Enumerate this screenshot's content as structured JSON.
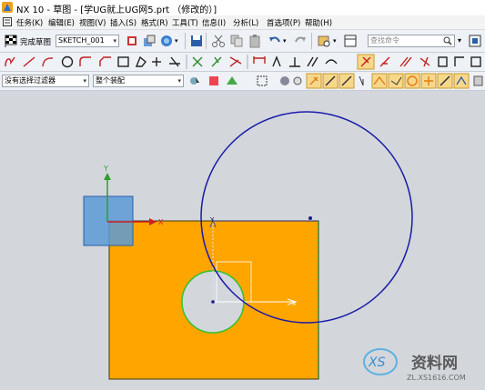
{
  "window": {
    "title": "NX 10 - 草图 - [学UG就上UG网5.prt （修改的）]"
  },
  "menu": {
    "items": [
      "任务(K)",
      "编辑(E)",
      "视图(V)",
      "插入(S)",
      "格式(R)",
      "工具(T)",
      "信息(I)",
      "分析(L)",
      "首选项(P)",
      "帮助(H)"
    ]
  },
  "toolbar1": {
    "finish_sketch_label": "完成草图",
    "sketch_name": "SKETCH_001",
    "search_placeholder": "查找命令"
  },
  "toolbar3": {
    "filter_value": "没有选择过滤器",
    "assembly_value": "整个装配"
  },
  "canvas": {
    "axis_label_x": "X",
    "axis_label_y": "Y",
    "sketch_axis_x": "X",
    "sketch_axis_y": "Y"
  },
  "colors": {
    "part_fill": "#ffa500",
    "circle_stroke": "#1a1aa8",
    "canvas_bg": "#d3d7dc"
  },
  "watermark": {
    "brand": "资料网",
    "url": "ZL.XS1616.COM"
  }
}
